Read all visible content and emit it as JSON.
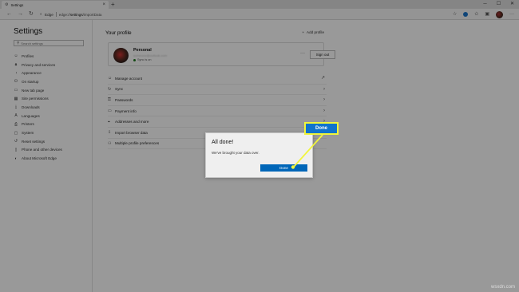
{
  "browser": {
    "tab_title": "Settings",
    "tab_favicon": "gear-icon",
    "address_site": "Edge",
    "url_prefix": "edge://",
    "url_bold": "settings",
    "url_suffix": "/importData"
  },
  "sidebar": {
    "title": "Settings",
    "search_placeholder": "Search settings",
    "items": [
      {
        "label": "Profiles",
        "icon": "person-icon"
      },
      {
        "label": "Privacy and services",
        "icon": "lock-icon"
      },
      {
        "label": "Appearance",
        "icon": "palette-icon"
      },
      {
        "label": "On startup",
        "icon": "power-icon"
      },
      {
        "label": "New tab page",
        "icon": "tab-icon"
      },
      {
        "label": "Site permissions",
        "icon": "grid-icon"
      },
      {
        "label": "Downloads",
        "icon": "download-icon"
      },
      {
        "label": "Languages",
        "icon": "language-icon"
      },
      {
        "label": "Printers",
        "icon": "printer-icon"
      },
      {
        "label": "System",
        "icon": "computer-icon"
      },
      {
        "label": "Reset settings",
        "icon": "reset-icon"
      },
      {
        "label": "Phone and other devices",
        "icon": "phone-icon"
      },
      {
        "label": "About Microsoft Edge",
        "icon": "edge-icon"
      }
    ]
  },
  "profile": {
    "title": "Your profile",
    "add_profile": "Add profile",
    "name": "Personal",
    "email": "someone@outlook.com",
    "sync_status": "Sync is on",
    "sign_out": "Sign out",
    "more": "···"
  },
  "rows": [
    {
      "label": "Manage account",
      "icon": "account-icon",
      "chevron": "↗"
    },
    {
      "label": "Sync",
      "icon": "sync-icon",
      "chevron": "›"
    },
    {
      "label": "Passwords",
      "icon": "key-icon",
      "chevron": "›"
    },
    {
      "label": "Payment info",
      "icon": "card-icon",
      "chevron": "›"
    },
    {
      "label": "Addresses and more",
      "icon": "pin-icon",
      "chevron": "›"
    },
    {
      "label": "Import browser data",
      "icon": "import-icon",
      "chevron": ""
    },
    {
      "label": "Multiple profile preferences",
      "icon": "people-icon",
      "chevron": ""
    }
  ],
  "dialog": {
    "title": "All done!",
    "message": "We've brought your data over.",
    "button": "Done"
  },
  "callout": {
    "label": "Done",
    "fill": "#1074cc",
    "border": "#f1f53a"
  },
  "watermark": "wsxdn.com"
}
